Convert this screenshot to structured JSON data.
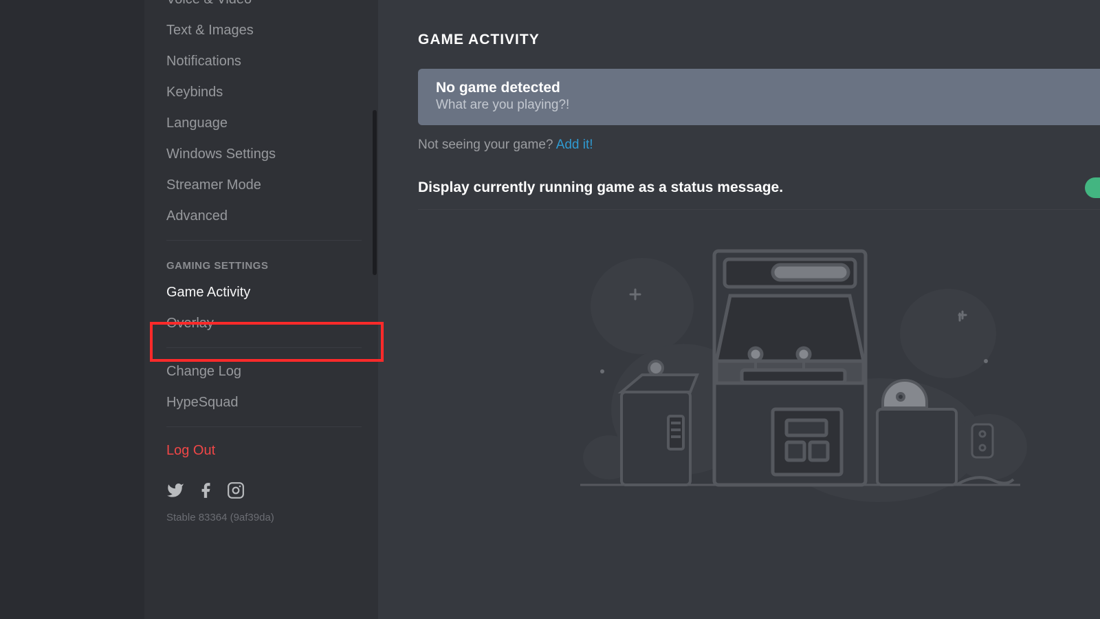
{
  "sidebar": {
    "items_top": [
      "Voice & Video",
      "Text & Images",
      "Notifications",
      "Keybinds",
      "Language",
      "Windows Settings",
      "Streamer Mode",
      "Advanced"
    ],
    "gaming_header": "GAMING SETTINGS",
    "gaming_items": [
      "Game Activity",
      "Overlay"
    ],
    "misc_items": [
      "Change Log",
      "HypeSquad"
    ],
    "logout": "Log Out",
    "version": "Stable 83364 (9af39da)"
  },
  "main": {
    "title": "GAME ACTIVITY",
    "card_title": "No game detected",
    "card_sub": "What are you playing?!",
    "hint_text": "Not seeing your game? ",
    "hint_link": "Add it!",
    "toggle_label": "Display currently running game as a status message."
  }
}
